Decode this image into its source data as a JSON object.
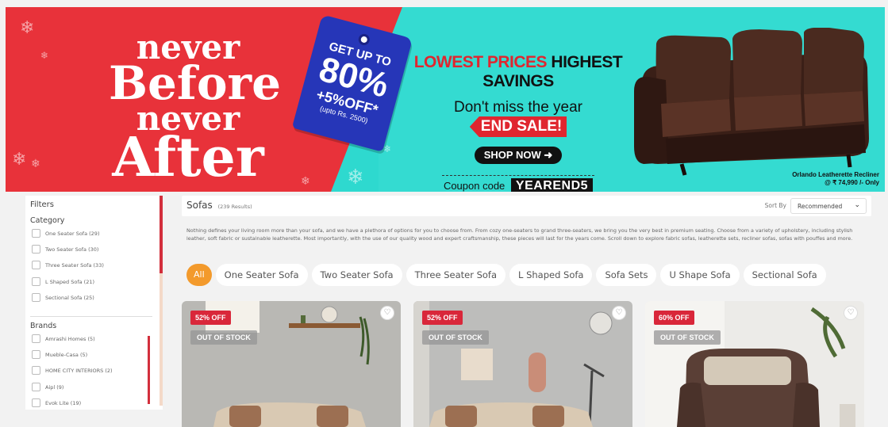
{
  "banner": {
    "headline": [
      "never",
      "Before",
      "never",
      "After"
    ],
    "tag": {
      "line1": "GET UP TO",
      "line2": "80%",
      "line3": "+5%OFF*",
      "line4": "(upto Rs. 2500)"
    },
    "lowest_prices": "LOWEST PRICES",
    "highest_savings": "HIGHEST SAVINGS",
    "dont_miss": "Don't miss the year",
    "end_sale": "END SALE!",
    "shop_now": "SHOP NOW",
    "coupon_label": "Coupon code",
    "coupon_code": "YEAREND5",
    "product_name": "Orlando Leatherette Recliner",
    "product_price": "@ ₹ 74,990 /- Only"
  },
  "sidebar": {
    "title": "Filters",
    "category_title": "Category",
    "categories": [
      "One Seater Sofa (29)",
      "Two Seater Sofa (30)",
      "Three Seater Sofa (33)",
      "L Shaped Sofa (21)",
      "Sectional Sofa (25)"
    ],
    "brands_title": "Brands",
    "brands": [
      "Amrashi Homes (5)",
      "Mueble-Casa (5)",
      "HOME CITY INTERIORS (2)",
      "Aipl (9)",
      "Evok Lite (19)"
    ]
  },
  "listing": {
    "title": "Sofas",
    "count": "(239 Results)",
    "sort_label": "Sort By",
    "sort_value": "Recommended",
    "description": "Nothing defines your living room more than your sofa, and we have a plethora of options for you to choose from. From cozy one-seaters to grand three-seaters, we bring you the very best in premium seating. Choose from a variety of upholstery, including stylish leather, soft fabric or sustainable leatherette. Most importantly, with the use of our quality wood and expert craftsmanship, these pieces will last for the years come. Scroll down to explore fabric sofas, leatherette sets, recliner sofas, sofas with pouffes and more.",
    "chips": [
      "All",
      "One Seater Sofa",
      "Two Seater Sofa",
      "Three Seater Sofa",
      "L Shaped Sofa",
      "Sofa Sets",
      "U Shape Sofa",
      "Sectional Sofa"
    ]
  },
  "products": [
    {
      "discount": "52% OFF",
      "status": "OUT OF STOCK"
    },
    {
      "discount": "52% OFF",
      "status": "OUT OF STOCK"
    },
    {
      "discount": "60% OFF",
      "status": "OUT OF STOCK"
    }
  ],
  "colors": {
    "accent": "#f39a2c",
    "sale_red": "#d9273a",
    "banner_red": "#e8323a",
    "banner_teal": "#34dbd1",
    "tag_blue": "#2636b8"
  },
  "icons": {
    "wishlist": "heart-icon",
    "sort": "chevron-down-icon",
    "shop": "arrow-circle-icon"
  }
}
